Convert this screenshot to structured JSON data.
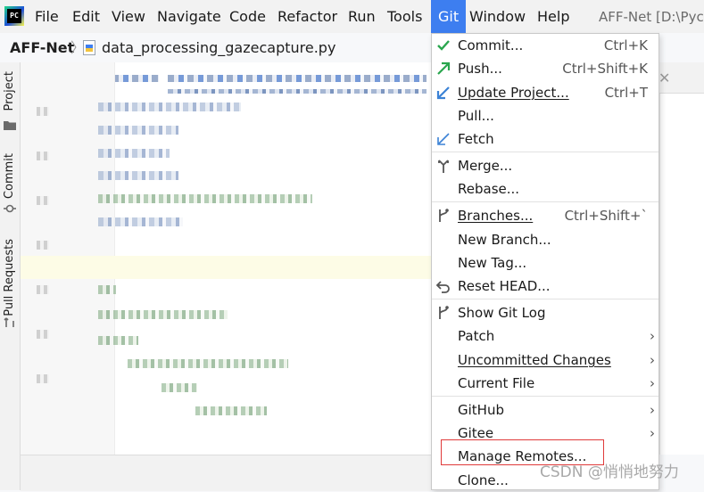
{
  "menubar": {
    "logo_text": "PC",
    "items": [
      "File",
      "Edit",
      "View",
      "Navigate",
      "Code",
      "Refactor",
      "Run",
      "Tools",
      "Git",
      "Window",
      "Help"
    ],
    "active_item": "Git",
    "window_title": "AFF-Net [D:\\Pych"
  },
  "breadcrumb": {
    "project": "AFF-Net",
    "file": "data_processing_gazecapture.py"
  },
  "tool_window_tabs": [
    "Project",
    "Commit",
    "Pull Requests"
  ],
  "git_menu": {
    "items": [
      {
        "label": "Commit...",
        "shortcut": "Ctrl+K",
        "icon": "check-icon",
        "icon_color": "#2aa64e"
      },
      {
        "label": "Push...",
        "shortcut": "Ctrl+Shift+K",
        "icon": "push-arrow-icon",
        "icon_color": "#2aa64e"
      },
      {
        "label": "Update Project...",
        "shortcut": "Ctrl+T",
        "icon": "update-arrow-icon",
        "icon_color": "#3b82d6"
      },
      {
        "label": "Pull...",
        "shortcut": "",
        "icon": "",
        "icon_color": ""
      },
      {
        "label": "Fetch",
        "shortcut": "",
        "icon": "fetch-arrow-icon",
        "icon_color": "#3b82d6"
      },
      {
        "label": "Merge...",
        "shortcut": "",
        "icon": "merge-icon",
        "icon_color": "#555555"
      },
      {
        "label": "Rebase...",
        "shortcut": "",
        "icon": "",
        "icon_color": ""
      },
      {
        "label": "Branches...",
        "shortcut": "Ctrl+Shift+`",
        "icon": "branch-icon",
        "icon_color": "#555555"
      },
      {
        "label": "New Branch...",
        "shortcut": "",
        "icon": "",
        "icon_color": ""
      },
      {
        "label": "New Tag...",
        "shortcut": "",
        "icon": "",
        "icon_color": ""
      },
      {
        "label": "Reset HEAD...",
        "shortcut": "",
        "icon": "undo-icon",
        "icon_color": "#555555"
      },
      {
        "label": "Show Git Log",
        "shortcut": "",
        "icon": "git-log-icon",
        "icon_color": "#555555"
      },
      {
        "label": "Patch",
        "shortcut": "",
        "submenu": true
      },
      {
        "label": "Uncommitted Changes",
        "shortcut": "",
        "submenu": true
      },
      {
        "label": "Current File",
        "shortcut": "",
        "submenu": true
      },
      {
        "label": "GitHub",
        "shortcut": "",
        "submenu": true
      },
      {
        "label": "Gitee",
        "shortcut": "",
        "submenu": true
      },
      {
        "label": "Manage Remotes...",
        "shortcut": ""
      },
      {
        "label": "Clone...",
        "shortcut": ""
      }
    ],
    "highlighted_item": "Manage Remotes...",
    "highlight_color": "#e03a3a"
  },
  "watermark": "CSDN @悄悄地努力",
  "accent_color": "#3d7ef0"
}
